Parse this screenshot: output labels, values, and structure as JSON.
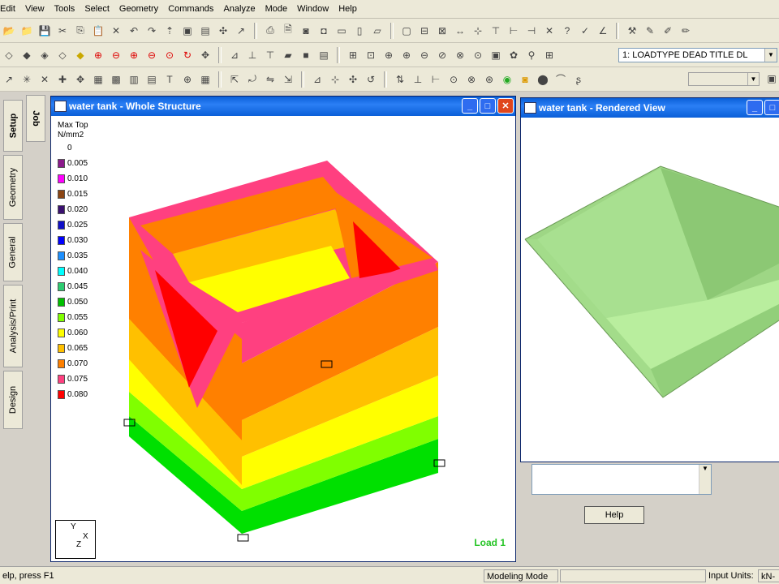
{
  "menu": [
    "Edit",
    "View",
    "Tools",
    "Select",
    "Geometry",
    "Commands",
    "Analyze",
    "Mode",
    "Window",
    "Help"
  ],
  "toolbar": {
    "load_case": "1: LOADTYPE DEAD  TITLE DL"
  },
  "left_tabs": {
    "setup": "Setup",
    "geometry": "Geometry",
    "general": "General",
    "analysis": "Analysis/Print",
    "design": "Design",
    "job": "Job"
  },
  "window_structure": {
    "title": "water tank - Whole Structure",
    "legend_title": "Max Top",
    "legend_unit": "N/mm2",
    "legend": [
      {
        "label": "0",
        "color": ""
      },
      {
        "label": "0.005",
        "color": "#8b1a8b"
      },
      {
        "label": "0.010",
        "color": "#ff00ff"
      },
      {
        "label": "0.015",
        "color": "#8b4513"
      },
      {
        "label": "0.020",
        "color": "#3a1070"
      },
      {
        "label": "0.025",
        "color": "#1010c8"
      },
      {
        "label": "0.030",
        "color": "#0000ff"
      },
      {
        "label": "0.035",
        "color": "#1e90ff"
      },
      {
        "label": "0.040",
        "color": "#00ffff"
      },
      {
        "label": "0.045",
        "color": "#2ecc71"
      },
      {
        "label": "0.050",
        "color": "#00c000"
      },
      {
        "label": "0.055",
        "color": "#80ff00"
      },
      {
        "label": "0.060",
        "color": "#ffff00"
      },
      {
        "label": "0.065",
        "color": "#ffc000"
      },
      {
        "label": "0.070",
        "color": "#ff8000"
      },
      {
        "label": "0.075",
        "color": "#ff4080"
      },
      {
        "label": "0.080",
        "color": "#ff0000"
      }
    ],
    "load_label": "Load 1",
    "axis_y": "Y",
    "axis_x": "X",
    "axis_z": "Z"
  },
  "window_rendered": {
    "title": "water tank - Rendered View"
  },
  "lower_panel": {
    "help_label": "Help"
  },
  "status": {
    "hint": "elp, press F1",
    "mode": "Modeling Mode",
    "units_label": "Input Units:",
    "units_value": "kN-m"
  }
}
